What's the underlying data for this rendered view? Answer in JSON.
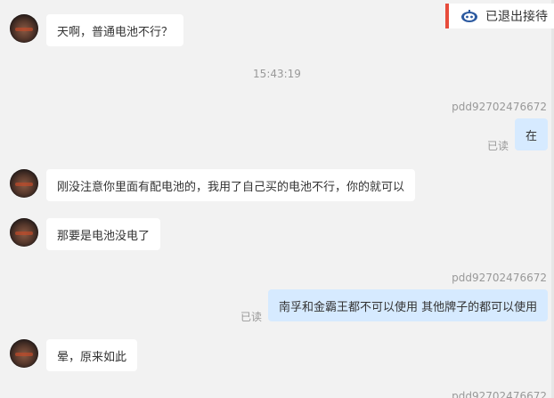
{
  "status": {
    "label": "已退出接待",
    "icon": "robot-icon",
    "accent": "#e74c3c"
  },
  "timestamp": "15:43:19",
  "messages": [
    {
      "side": "in",
      "text": "天啊，普通电池不行？"
    },
    {
      "side": "out",
      "sender": "pdd92702476672",
      "text": "在",
      "read": "已读"
    },
    {
      "side": "in",
      "text": "刚没注意你里面有配电池的，我用了自己买的电池不行，你的就可以"
    },
    {
      "side": "in",
      "text": "那要是电池没电了"
    },
    {
      "side": "out",
      "sender": "pdd92702476672",
      "text": "南孚和金霸王都不可以使用 其他牌子的都可以使用",
      "read": "已读"
    },
    {
      "side": "in",
      "text": "晕，原来如此"
    }
  ],
  "footer_sender_partial": "pdd92702476672",
  "colors": {
    "background": "#f2f2f2",
    "incoming_bubble": "#ffffff",
    "outgoing_bubble": "#d6eaff",
    "meta_text": "#999999"
  }
}
